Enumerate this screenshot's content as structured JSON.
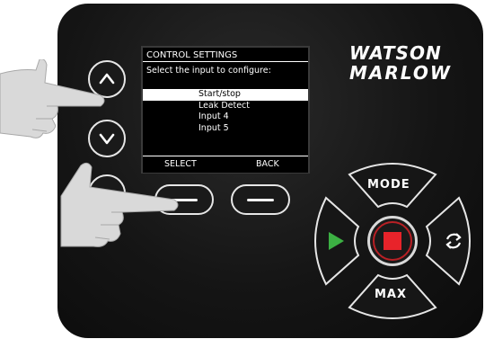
{
  "display": {
    "title": "CONTROL SETTINGS",
    "prompt": "Select the input to configure:",
    "menu_items": [
      {
        "label": "Start/stop",
        "selected": true
      },
      {
        "label": "Leak Detect",
        "selected": false
      },
      {
        "label": "Input 4",
        "selected": false
      },
      {
        "label": "Input 5",
        "selected": false
      }
    ],
    "softkeys": {
      "left": "SELECT",
      "right": "BACK"
    }
  },
  "brand": {
    "line1": "WATSON",
    "line2": "MARLOW"
  },
  "controls": {
    "mode_label": "MODE",
    "max_label": "MAX"
  },
  "colors": {
    "panel": "#151515",
    "stop_red": "#e8232a",
    "run_green": "#3cb043",
    "button_outline": "#e6e6e6"
  },
  "icons": {
    "up": "chevron-up-icon",
    "down": "chevron-down-icon",
    "run": "play-icon",
    "stop": "stop-icon",
    "direction": "rotate-icon"
  }
}
